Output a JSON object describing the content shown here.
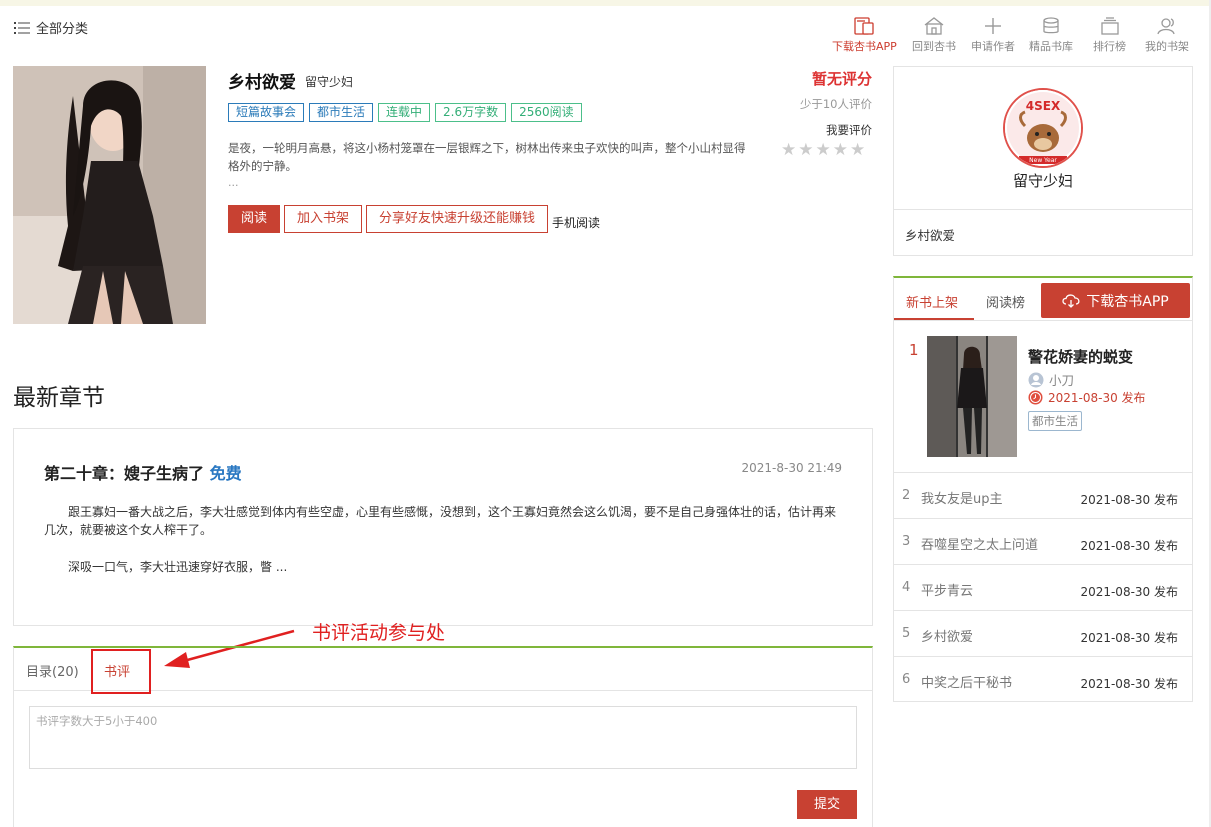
{
  "header": {
    "all_categories": "全部分类",
    "nav": [
      {
        "label": "下载杏书APP",
        "icon": "tablet-download-icon",
        "active": true
      },
      {
        "label": "回到杏书",
        "icon": "home-icon"
      },
      {
        "label": "申请作者",
        "icon": "plus-icon"
      },
      {
        "label": "精品书库",
        "icon": "database-icon"
      },
      {
        "label": "排行榜",
        "icon": "layers-icon"
      },
      {
        "label": "我的书架",
        "icon": "users-icon"
      }
    ]
  },
  "book": {
    "title": "乡村欲爱",
    "author": "留守少妇",
    "tags": [
      "短篇故事会",
      "都市生活",
      "连载中",
      "2.6万字数",
      "2560阅读"
    ],
    "description": "是夜，一轮明月高悬，将这小杨村笼罩在一层银辉之下，树林出传来虫子欢快的叫声，整个小山村显得格外的宁静。",
    "ellipsis": "...",
    "buttons": {
      "read": "阅读",
      "add_shelf": "加入书架",
      "share": "分享好友快速升级还能赚钱",
      "mobile": "手机阅读"
    },
    "rating": "暂无评分",
    "rating_count": "少于10人评价",
    "rate_label": "我要评价",
    "stars": 5
  },
  "latest": {
    "heading": "最新章节",
    "chapter_title": "第二十章：嫂子生病了",
    "free_label": "免费",
    "time": "2021-8-30 21:49",
    "para1": "跟王寡妇一番大战之后，李大壮感觉到体内有些空虚，心里有些感慨，没想到，这个王寡妇竟然会这么饥渴，要不是自己身强体壮的话，估计再来几次，就要被这个女人榨干了。",
    "para2": "深吸一口气，李大壮迅速穿好衣服，瞥 ..."
  },
  "comments": {
    "tab_toc": "目录(20)",
    "tab_review": "书评",
    "placeholder": "书评字数大于5小于400",
    "submit": "提交",
    "annotation": "书评活动参与处"
  },
  "author_card": {
    "name": "留守少妇",
    "book": "乡村欲爱",
    "avatar_text": "4SEX",
    "avatar_caption": "New Year"
  },
  "ranking": {
    "tab_new": "新书上架",
    "tab_read": "阅读榜",
    "download": "下载杏书APP",
    "top": {
      "num": "1",
      "title": "警花娇妻的蜕变",
      "author": "小刀",
      "date": "2021-08-30 发布",
      "tag": "都市生活"
    },
    "rows": [
      {
        "num": "2",
        "name": "我女友是up主",
        "date": "2021-08-30 发布"
      },
      {
        "num": "3",
        "name": "吞噬星空之太上问道",
        "date": "2021-08-30 发布"
      },
      {
        "num": "4",
        "name": "平步青云",
        "date": "2021-08-30 发布"
      },
      {
        "num": "5",
        "name": "乡村欲爱",
        "date": "2021-08-30 发布"
      },
      {
        "num": "6",
        "name": "中奖之后干秘书",
        "date": "2021-08-30 发布"
      }
    ]
  }
}
